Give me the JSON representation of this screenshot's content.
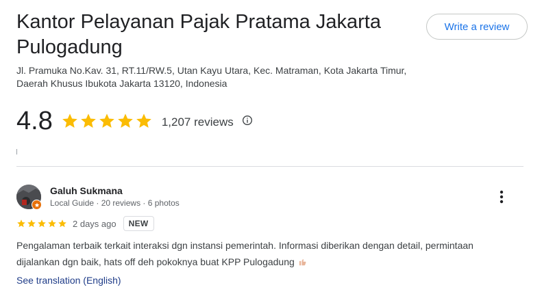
{
  "place": {
    "title": "Kantor Pelayanan Pajak Pratama Jakarta Pulogadung",
    "address": "Jl. Pramuka No.Kav. 31, RT.11/RW.5, Utan Kayu Utara, Kec. Matraman, Kota Jakarta Timur, Daerah Khusus Ibukota Jakarta 13120, Indonesia",
    "rating": "4.8",
    "stars": 5,
    "review_count": "1,207 reviews",
    "info_icon": "info-icon"
  },
  "actions": {
    "write_review_label": "Write a review"
  },
  "review": {
    "author": "Galuh Sukmana",
    "meta": "Local Guide · 20 reviews · 6 photos",
    "stars": 5,
    "time": "2 days ago",
    "badge": "NEW",
    "text": "Pengalaman terbaik terkait interaksi dgn instansi pemerintah. Informasi diberikan dengan detail, permintaan dijalankan dgn baik, hats off deh pokoknya buat KPP Pulogadung",
    "emoji_icon": "thumbs-up-icon",
    "translation_label": "See translation (English)",
    "more_icon": "more-vert-icon"
  },
  "colors": {
    "star": "#fbbc04",
    "link": "#1a73e8",
    "translation_link": "#1f3c88",
    "local_guide_badge": "#e8710a"
  }
}
